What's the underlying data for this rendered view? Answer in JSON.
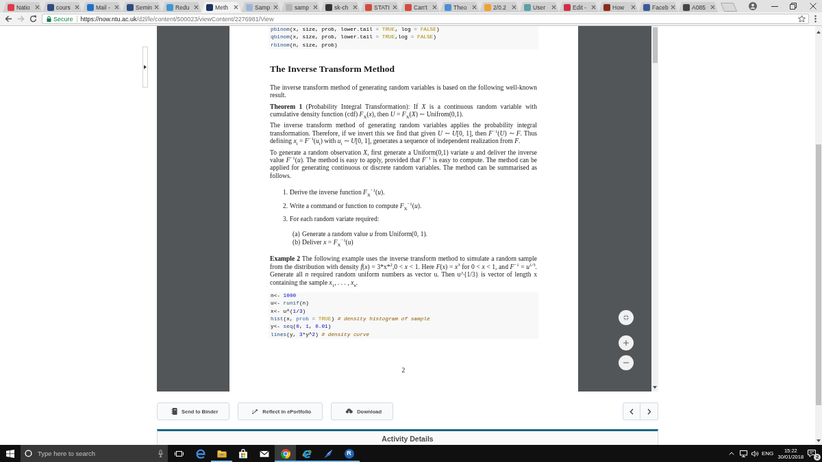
{
  "tabs": [
    {
      "title": "Natio",
      "color": "#e0394c",
      "selected": false
    },
    {
      "title": "cours",
      "color": "#2d4b80",
      "selected": false
    },
    {
      "title": "Mail -",
      "color": "#1a73c8",
      "selected": false
    },
    {
      "title": "Semin",
      "color": "#2d4b80",
      "selected": false
    },
    {
      "title": "Redu",
      "color": "#3d9ad1",
      "selected": false
    },
    {
      "title": "Meth",
      "color": "#1e3360",
      "selected": true
    },
    {
      "title": "Samp",
      "color": "#9fb3d9",
      "selected": false
    },
    {
      "title": "samp",
      "color": "#b5b5b5",
      "selected": false
    },
    {
      "title": "sk-ch",
      "color": "#333333",
      "selected": false
    },
    {
      "title": "STATI",
      "color": "#d34b3c",
      "selected": false
    },
    {
      "title": "Can't",
      "color": "#d34b3c",
      "selected": false
    },
    {
      "title": "Theo",
      "color": "#4a8fd8",
      "selected": false
    },
    {
      "title": "2/0.2",
      "color": "#f0a030",
      "selected": false
    },
    {
      "title": "User",
      "color": "#5aa0a8",
      "selected": false
    },
    {
      "title": "Edit -",
      "color": "#d02f45",
      "selected": false
    },
    {
      "title": "How",
      "color": "#8a2c1c",
      "selected": false
    },
    {
      "title": "Faceb",
      "color": "#3b5998",
      "selected": false
    },
    {
      "title": "A085",
      "color": "#444444",
      "selected": false
    }
  ],
  "address_bar": {
    "security": "Secure",
    "url_host": "https://now.ntu.ac.uk",
    "url_path": "/d2l/le/content/500023/viewContent/2276981/View"
  },
  "document": {
    "blocks": [
      {
        "kind": "code",
        "lines": [
          [
            {
              "text": "pbinom",
              "kind": "function"
            },
            {
              "text": "(x, size, prob, lower.tail ",
              "kind": "plain"
            },
            {
              "text": "= ",
              "kind": "operator"
            },
            {
              "text": "TRUE",
              "kind": "constant"
            },
            {
              "text": ", log ",
              "kind": "plain"
            },
            {
              "text": "= ",
              "kind": "operator"
            },
            {
              "text": "FALSE",
              "kind": "constant"
            },
            {
              "text": ")",
              "kind": "plain"
            }
          ],
          [
            {
              "text": "qbinom",
              "kind": "function"
            },
            {
              "text": "(x, size, prob, lower.tail ",
              "kind": "plain"
            },
            {
              "text": "= ",
              "kind": "operator"
            },
            {
              "text": "TRUE",
              "kind": "constant"
            },
            {
              "text": ",log ",
              "kind": "plain"
            },
            {
              "text": "= ",
              "kind": "operator"
            },
            {
              "text": "FALSE",
              "kind": "constant"
            },
            {
              "text": ")",
              "kind": "plain"
            }
          ],
          [
            {
              "text": "rbinom",
              "kind": "function"
            },
            {
              "text": "(n, size, prob)",
              "kind": "plain"
            }
          ]
        ]
      },
      {
        "kind": "heading",
        "text": "The Inverse Transform Method"
      },
      {
        "kind": "paragraph",
        "text": "The inverse transform method of generating random variables is based on the following well-known result."
      },
      {
        "kind": "paragraph",
        "text": "**Theorem 1** (Probability Integral Transformation): If *X* is a continuous random variable with cumulative density function (cdf) *F*$_{X}$(*x*), then *U* = *F*$_{X}$(*X*) ∼ Unifrom(0,1)."
      },
      {
        "kind": "paragraph",
        "text": "The inverse transform method of generating random variables applies the probability integral transformation. Therefore, if we invert this we find that given *U* ∼ *U*[0, 1], then *F*$^{−1}$(*U*) ∼ *F*. Thus defining *x*$_{i}$ = *F*$^{−1}$(*u*$_{i}$) with *u*$_{i}$ ∼ *U*[0, 1], generates a sequence of independent realization from *F*."
      },
      {
        "kind": "paragraph",
        "text": "To generate a random observation *X*, first generate a Uniform(0,1) variate *u* and deliver the inverse value *F*$^{−1}$(*u*). The method is easy to apply, provided that *F*$^{−1}$ is easy to compute. The method can be applied for generating continuous or discrete random variables. The method can be summarised as follows."
      },
      {
        "kind": "list",
        "items": [
          {
            "marker": "1.",
            "text": "Derive the inverse function *F*$_{X}$$^{−1}$(*u*)."
          },
          {
            "marker": "2.",
            "text": "Write a command or function to compute *F*$_{X}$$^{−1}$(*u*)."
          },
          {
            "marker": "3.",
            "text": "For each random variate required:",
            "children": [
              {
                "marker": "(a)",
                "text": "Generate a random value *u* from Uniform(0, 1)."
              },
              {
                "marker": "(b)",
                "text": "Deliver *x* = *F*$_{X}$$^{−1}$(*u*)"
              }
            ]
          }
        ]
      },
      {
        "kind": "paragraph",
        "text": "**Example 2** The following example uses the inverse transform method to simulate a random sample from the distribution with density *f*(*x*) = 3*x*$^{2}$,0 < *x* < 1. Here *F*(*x*) = *x*$^{3}$ for 0 < *x* < 1, and *F*$^{−1}$ = *u*$^{1/3}$. Generate all *n* required random uniform numbers as vector u. Then u^{1/3} is vector of length x containing the sample *x*$_{1}$, . . . , *x*$_{n}$."
      },
      {
        "kind": "code",
        "lines": [
          [
            {
              "text": "n<- ",
              "kind": "plain"
            },
            {
              "text": "1000",
              "kind": "number"
            }
          ],
          [
            {
              "text": "u<- ",
              "kind": "plain"
            },
            {
              "text": "runif",
              "kind": "function"
            },
            {
              "text": "(n)",
              "kind": "plain"
            }
          ],
          [
            {
              "text": "x<- u^(",
              "kind": "plain"
            },
            {
              "text": "1",
              "kind": "number"
            },
            {
              "text": "/",
              "kind": "plain"
            },
            {
              "text": "3",
              "kind": "number"
            },
            {
              "text": ")",
              "kind": "plain"
            }
          ],
          [
            {
              "text": "hist",
              "kind": "function"
            },
            {
              "text": "(x, ",
              "kind": "plain"
            },
            {
              "text": "prob ",
              "kind": "argument"
            },
            {
              "text": "= ",
              "kind": "operator"
            },
            {
              "text": "TRUE",
              "kind": "constant"
            },
            {
              "text": ") ",
              "kind": "plain"
            },
            {
              "text": "# density histogram of sample",
              "kind": "comment"
            }
          ],
          [
            {
              "text": "y<- ",
              "kind": "plain"
            },
            {
              "text": "seq",
              "kind": "function"
            },
            {
              "text": "(",
              "kind": "plain"
            },
            {
              "text": "0",
              "kind": "number"
            },
            {
              "text": ", ",
              "kind": "plain"
            },
            {
              "text": "1",
              "kind": "number"
            },
            {
              "text": ", ",
              "kind": "plain"
            },
            {
              "text": "0.01",
              "kind": "number"
            },
            {
              "text": ")",
              "kind": "plain"
            }
          ],
          [
            {
              "text": "lines",
              "kind": "function"
            },
            {
              "text": "(y, ",
              "kind": "plain"
            },
            {
              "text": "3",
              "kind": "number"
            },
            {
              "text": "*y^",
              "kind": "plain"
            },
            {
              "text": "2",
              "kind": "number"
            },
            {
              "text": ") ",
              "kind": "plain"
            },
            {
              "text": "# density curve",
              "kind": "comment"
            }
          ]
        ]
      }
    ],
    "page_number": "2"
  },
  "actions": [
    {
      "label": "Send to Binder",
      "kind": "binder"
    },
    {
      "label": "Reflect in ePortfolio",
      "kind": "reflect"
    },
    {
      "label": "Download",
      "kind": "download"
    }
  ],
  "activity_panel": {
    "title": "Activity Details"
  },
  "taskbar": {
    "search": {
      "placeholder": "Type here to search"
    },
    "apps": [
      {
        "kind": "edge",
        "running": false,
        "selected": false
      },
      {
        "kind": "folder",
        "running": true,
        "selected": false
      },
      {
        "kind": "store",
        "running": false,
        "selected": false
      },
      {
        "kind": "mail",
        "running": false,
        "selected": false
      },
      {
        "kind": "chrome",
        "running": true,
        "selected": true
      },
      {
        "kind": "ie",
        "running": true,
        "selected": false
      },
      {
        "kind": "pen",
        "running": true,
        "selected": false
      },
      {
        "kind": "letter",
        "label": "R",
        "running": true,
        "selected": false
      }
    ],
    "language": "ENG",
    "time": "15:22",
    "date": "30/01/2018",
    "notifications": "2"
  }
}
